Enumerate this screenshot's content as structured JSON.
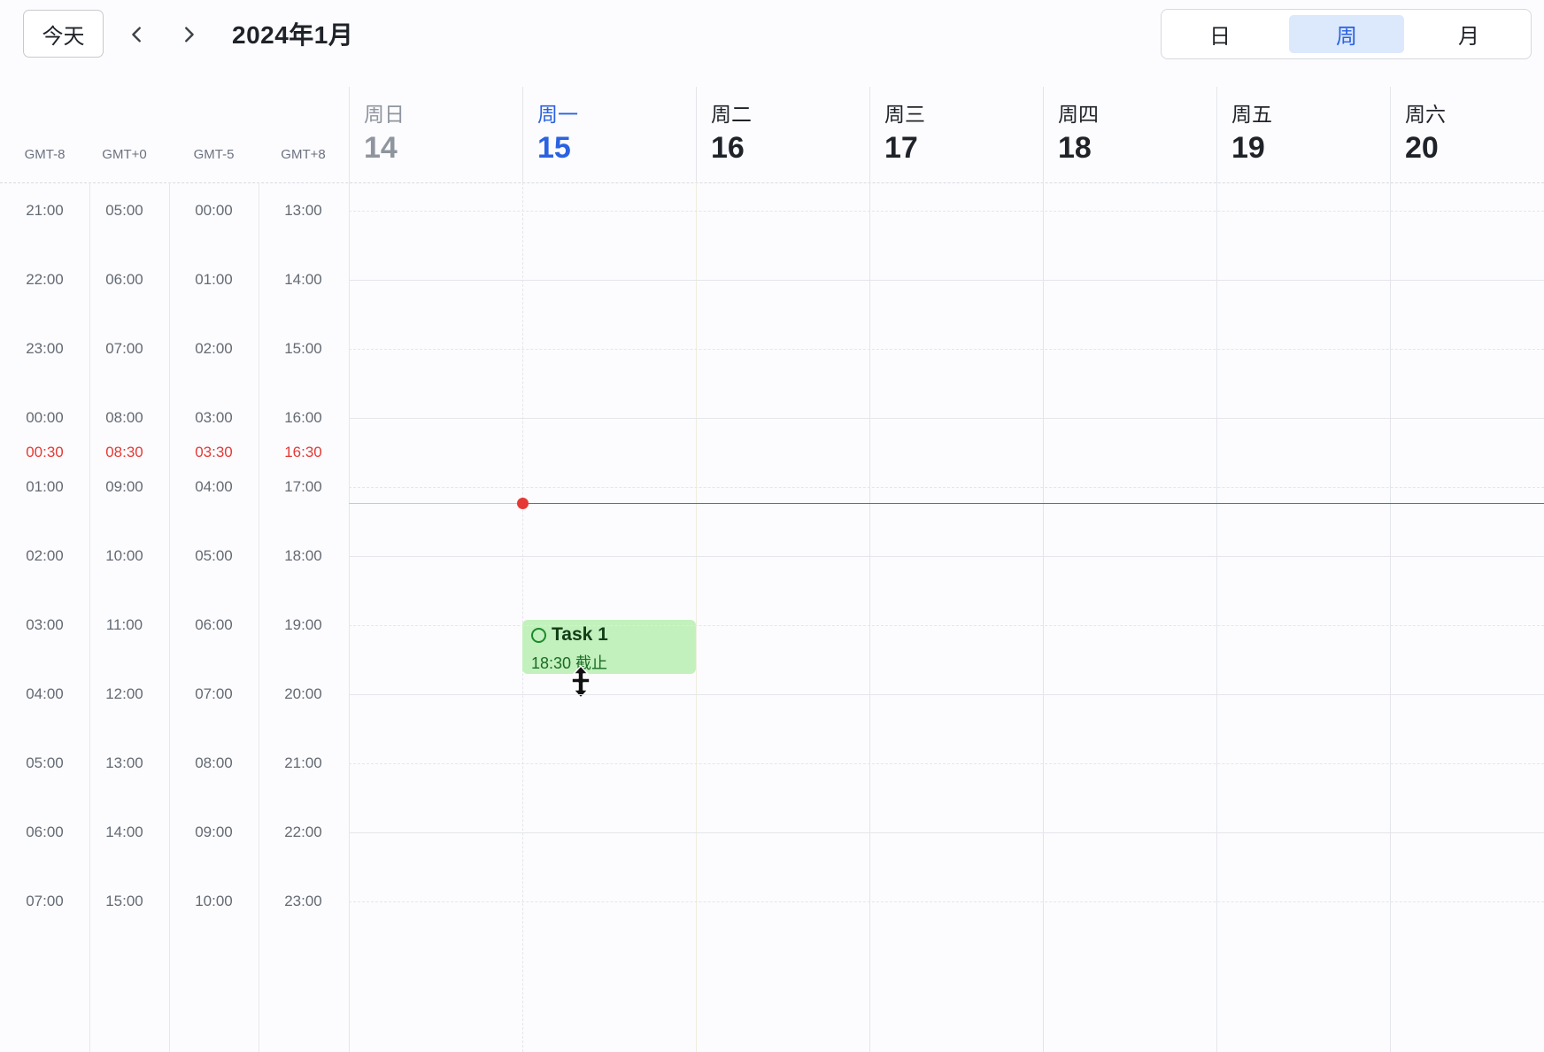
{
  "toolbar": {
    "today_label": "今天",
    "month_title": "2024年1月",
    "prev_icon": "chevron-left-icon",
    "next_icon": "chevron-right-icon",
    "views": [
      "日",
      "周",
      "月"
    ],
    "active_view": "周"
  },
  "timezones": [
    "GMT-8",
    "GMT+0",
    "GMT-5",
    "GMT+8"
  ],
  "days": [
    {
      "name": "周日",
      "date": "14"
    },
    {
      "name": "周一",
      "date": "15"
    },
    {
      "name": "周二",
      "date": "16"
    },
    {
      "name": "周三",
      "date": "17"
    },
    {
      "name": "周四",
      "date": "18"
    },
    {
      "name": "周五",
      "date": "19"
    },
    {
      "name": "周六",
      "date": "20"
    }
  ],
  "time_rows": {
    "GMT-8": [
      "21:00",
      "22:00",
      "23:00",
      "00:00",
      "01:00",
      "02:00",
      "03:00",
      "04:00",
      "05:00",
      "06:00",
      "07:00"
    ],
    "GMT+0": [
      "05:00",
      "06:00",
      "07:00",
      "08:00",
      "09:00",
      "10:00",
      "11:00",
      "12:00",
      "13:00",
      "14:00",
      "15:00"
    ],
    "GMT-5": [
      "00:00",
      "01:00",
      "02:00",
      "03:00",
      "04:00",
      "05:00",
      "06:00",
      "07:00",
      "08:00",
      "09:00",
      "10:00"
    ],
    "GMT+8": [
      "13:00",
      "14:00",
      "15:00",
      "16:00",
      "17:00",
      "18:00",
      "19:00",
      "20:00",
      "21:00",
      "22:00",
      "23:00"
    ]
  },
  "now_times": [
    "00:30",
    "08:30",
    "03:30",
    "16:30"
  ],
  "event": {
    "title": "Task 1",
    "time_text": "18:30 截止",
    "icon": "circle-icon",
    "color": "#c2f1bd"
  },
  "colors": {
    "accent": "#2a62e0",
    "now_line": "#e53935"
  }
}
